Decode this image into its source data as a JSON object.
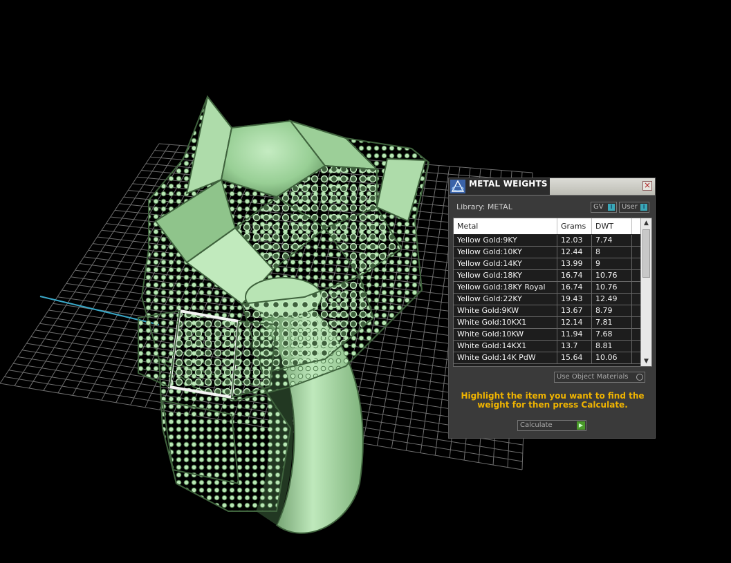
{
  "panel": {
    "title": "METAL WEIGHTS",
    "close_icon": "close-icon",
    "library_label": "Library: METAL",
    "gv_label": "GV",
    "user_label": "User",
    "indicator_char": "I",
    "columns": [
      "Metal",
      "Grams",
      "DWT"
    ],
    "rows": [
      {
        "metal": "Yellow Gold:9KY",
        "grams": "12.03",
        "dwt": "7.74"
      },
      {
        "metal": "Yellow Gold:10KY",
        "grams": "12.44",
        "dwt": "8"
      },
      {
        "metal": "Yellow Gold:14KY",
        "grams": "13.99",
        "dwt": "9"
      },
      {
        "metal": "Yellow Gold:18KY",
        "grams": "16.74",
        "dwt": "10.76"
      },
      {
        "metal": "Yellow Gold:18KY Royal",
        "grams": "16.74",
        "dwt": "10.76"
      },
      {
        "metal": "Yellow Gold:22KY",
        "grams": "19.43",
        "dwt": "12.49"
      },
      {
        "metal": "White Gold:9KW",
        "grams": "13.67",
        "dwt": "8.79"
      },
      {
        "metal": "White Gold:10KX1",
        "grams": "12.14",
        "dwt": "7.81"
      },
      {
        "metal": "White Gold:10KW",
        "grams": "11.94",
        "dwt": "7.68"
      },
      {
        "metal": "White Gold:14KX1",
        "grams": "13.7",
        "dwt": "8.81"
      },
      {
        "metal": "White Gold:14K PdW",
        "grams": "15.64",
        "dwt": "10.06"
      }
    ],
    "use_object_materials": "Use Object Materials",
    "hint": "Highlight the item you want to find the weight for then press Calculate.",
    "calculate_label": "Calculate",
    "colors": {
      "hint": "#f0b400",
      "accent": "#3aa8b8",
      "model": "#9fd49e"
    }
  }
}
